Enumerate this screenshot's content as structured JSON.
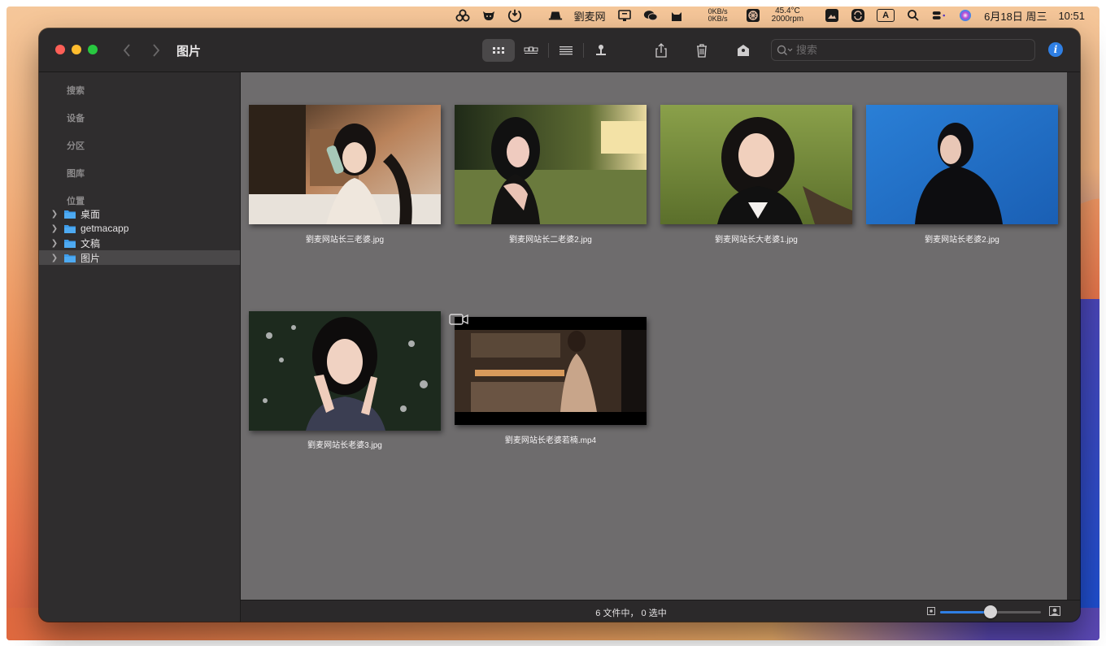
{
  "menubar": {
    "app_name": "劉麦网",
    "net_up": "0KB/s",
    "net_down": "0KB/s",
    "temp": "45.4°C",
    "fan": "2000rpm",
    "input_method": "A",
    "date": "6月18日 周三",
    "time": "10:51"
  },
  "window": {
    "title": "图片",
    "search_placeholder": "搜索",
    "info_label": "i"
  },
  "sidebar": {
    "sections": [
      "搜索",
      "设备",
      "分区",
      "图库",
      "位置"
    ],
    "locations": [
      {
        "label": "桌面",
        "selected": false
      },
      {
        "label": "getmacapp",
        "selected": false
      },
      {
        "label": "文稿",
        "selected": false
      },
      {
        "label": "图片",
        "selected": true
      }
    ]
  },
  "files": [
    {
      "name": "劉麦网站长三老婆.jpg",
      "type": "image"
    },
    {
      "name": "劉麦网站长二老婆2.jpg",
      "type": "image"
    },
    {
      "name": "劉麦网站长大老婆1.jpg",
      "type": "image"
    },
    {
      "name": "劉麦网站长老婆2.jpg",
      "type": "image"
    },
    {
      "name": "劉麦网站长老婆3.jpg",
      "type": "image"
    },
    {
      "name": "劉麦网站长老婆若楠.mp4",
      "type": "video"
    }
  ],
  "status": {
    "text": "6 文件中， 0 选中",
    "zoom_level": 0.5
  },
  "colors": {
    "accent": "#2f7fe4",
    "close": "#fe5f57",
    "minimize": "#febc2e",
    "maximize": "#28c840"
  }
}
